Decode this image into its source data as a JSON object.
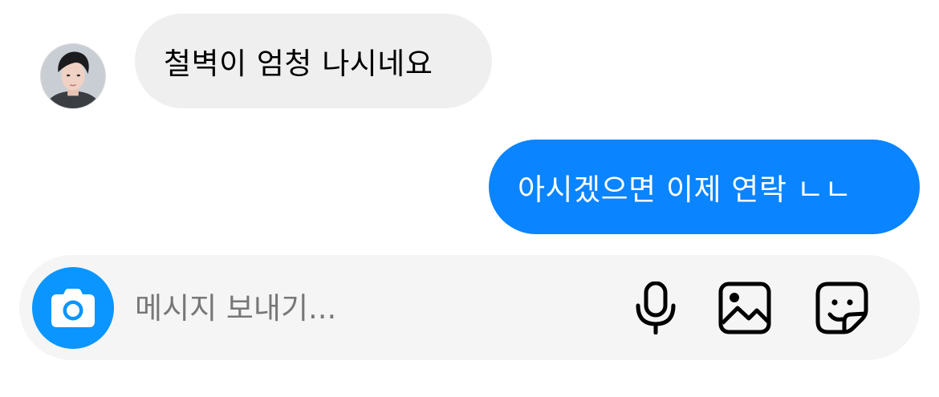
{
  "conversation": {
    "received_message": "철벽이 엄청 나시네요",
    "sent_message": "아시겠으면 이제 연락 ㄴㄴ"
  },
  "composer": {
    "placeholder": "메시지 보내기..."
  },
  "icons": {
    "avatar": "profile-photo",
    "camera": "camera-icon",
    "microphone": "microphone-icon",
    "gallery": "image-icon",
    "sticker": "sticker-icon"
  },
  "colors": {
    "sent_bubble": "#0a84ff",
    "received_bubble": "#efefef",
    "camera_button": "#0a95ff",
    "composer_background": "#f5f5f5"
  }
}
